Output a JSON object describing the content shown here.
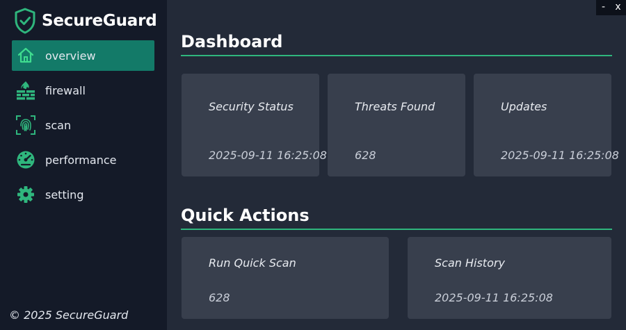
{
  "app": {
    "name": "SecureGuard"
  },
  "window_controls": {
    "minimize": "-",
    "close": "x"
  },
  "sidebar": {
    "items": [
      {
        "label": "overview",
        "icon": "home-icon",
        "active": true
      },
      {
        "label": "firewall",
        "icon": "firewall-icon",
        "active": false
      },
      {
        "label": "scan",
        "icon": "fingerprint-icon",
        "active": false
      },
      {
        "label": "performance",
        "icon": "gauge-icon",
        "active": false
      },
      {
        "label": "setting",
        "icon": "gear-icon",
        "active": false
      }
    ],
    "footer": "© 2025 SecureGuard"
  },
  "dashboard": {
    "title": "Dashboard",
    "cards": [
      {
        "title": "Security Status",
        "value": "2025-09-11 16:25:08"
      },
      {
        "title": "Threats Found",
        "value": "628"
      },
      {
        "title": "Updates",
        "value": "2025-09-11 16:25:08"
      }
    ]
  },
  "quick_actions": {
    "title": "Quick Actions",
    "cards": [
      {
        "title": "Run Quick Scan",
        "value": "628"
      },
      {
        "title": "Scan History",
        "value": "2025-09-11 16:25:08"
      }
    ]
  },
  "colors": {
    "accent": "#2fb67d",
    "active_nav": "#137a68",
    "sidebar_bg": "#141a28",
    "main_bg": "#232a38",
    "card_bg": "#383f4d"
  }
}
